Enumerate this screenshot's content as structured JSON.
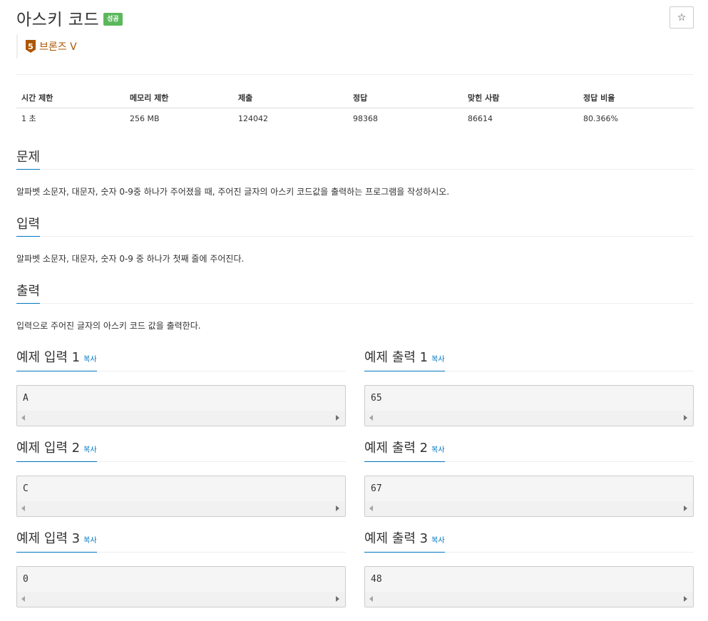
{
  "problem": {
    "title": "아스키 코드",
    "status_badge": "성공",
    "star_icon": "☆",
    "tier": {
      "number": "5",
      "label": "브론즈 V",
      "color": "#ad5600"
    }
  },
  "info": {
    "headers": [
      "시간 제한",
      "메모리 제한",
      "제출",
      "정답",
      "맞힌 사람",
      "정답 비율"
    ],
    "values": [
      "1 초",
      "256 MB",
      "124042",
      "98368",
      "86614",
      "80.366%"
    ]
  },
  "sections": {
    "problem": {
      "title": "문제",
      "text": "알파벳 소문자, 대문자, 숫자 0-9중 하나가 주어졌을 때, 주어진 글자의 아스키 코드값을 출력하는 프로그램을 작성하시오."
    },
    "input": {
      "title": "입력",
      "text": "알파벳 소문자, 대문자, 숫자 0-9 중 하나가 첫째 줄에 주어진다."
    },
    "output": {
      "title": "출력",
      "text": "입력으로 주어진 글자의 아스키 코드 값을 출력한다."
    }
  },
  "samples": {
    "copy_label": "복사",
    "items": [
      {
        "input_title": "예제 입력 1",
        "input": "A",
        "output_title": "예제 출력 1",
        "output": "65"
      },
      {
        "input_title": "예제 입력 2",
        "input": "C",
        "output_title": "예제 출력 2",
        "output": "67"
      },
      {
        "input_title": "예제 입력 3",
        "input": "0",
        "output_title": "예제 출력 3",
        "output": "48"
      }
    ]
  },
  "colors": {
    "accent": "#0076c0",
    "success": "#5cb85c",
    "bronze": "#ad5600"
  }
}
